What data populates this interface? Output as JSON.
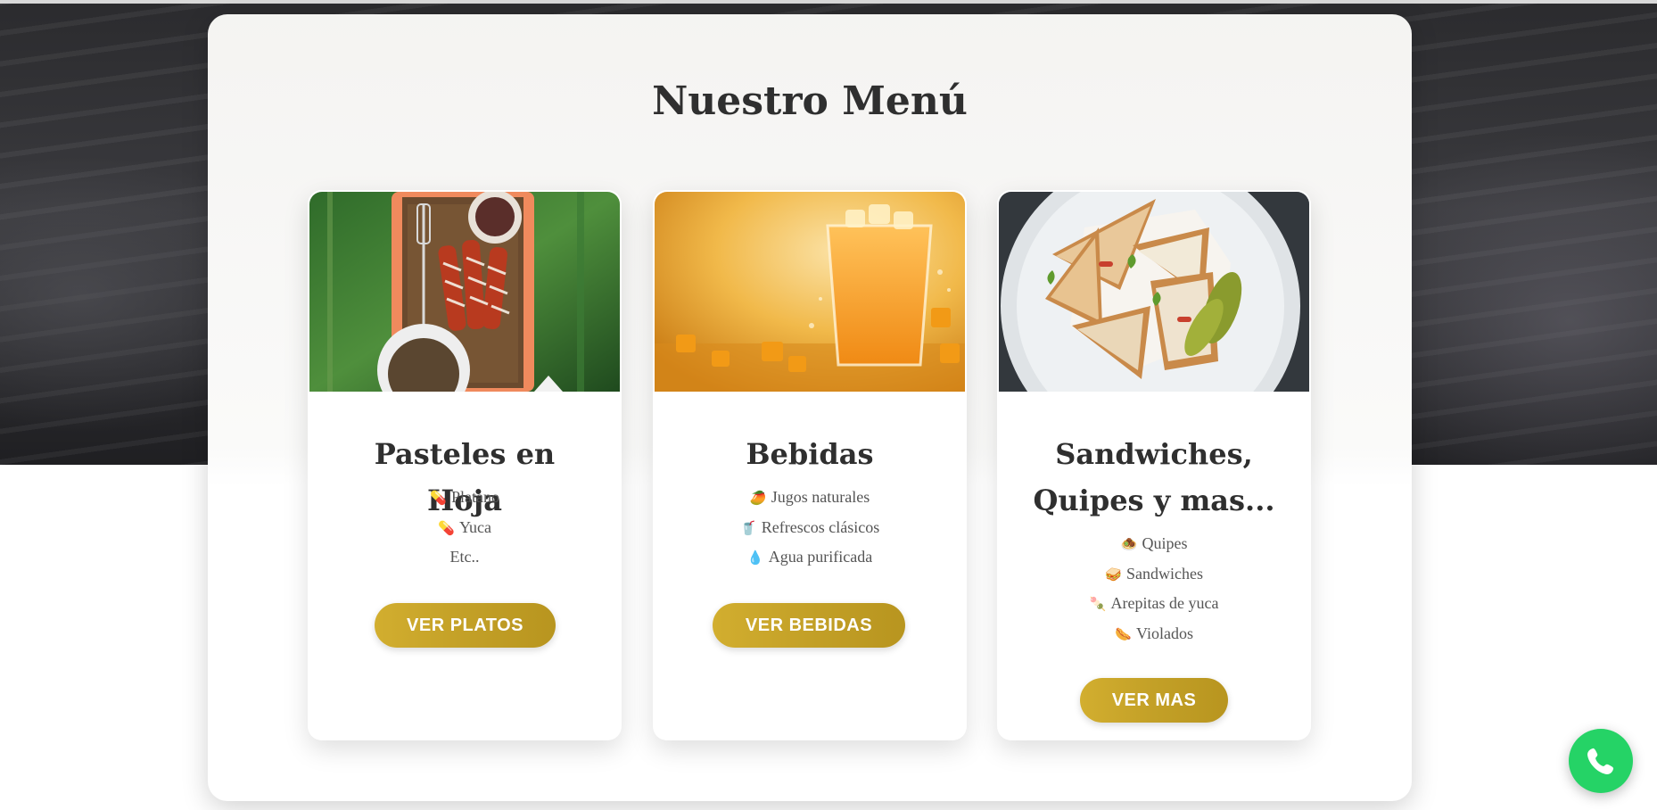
{
  "page": {
    "section_title": "Nuestro Menú"
  },
  "cards": [
    {
      "title": "Pasteles en Hoja",
      "items": [
        {
          "icon": "pill-icon",
          "text": "Platano"
        },
        {
          "icon": "pill-icon",
          "text": "Yuca"
        },
        {
          "icon": "",
          "text": "Etc.."
        }
      ],
      "button": "VER PLATOS",
      "image": "pasteles-en-hoja-photo"
    },
    {
      "title": "Bebidas",
      "items": [
        {
          "icon": "mango-icon",
          "text": "Jugos naturales"
        },
        {
          "icon": "soda-cup-icon",
          "text": "Refrescos clásicos"
        },
        {
          "icon": "droplet-icon",
          "text": "Agua purificada"
        }
      ],
      "button": "VER BEBIDAS",
      "image": "mango-juice-photo"
    },
    {
      "title": "Sandwiches, Quipes y mas...",
      "items": [
        {
          "icon": "kibbeh-icon",
          "text": "Quipes"
        },
        {
          "icon": "sandwich-icon",
          "text": "Sandwiches"
        },
        {
          "icon": "arepa-icon",
          "text": "Arepitas de yuca"
        },
        {
          "icon": "sausage-icon",
          "text": "Violados"
        }
      ],
      "button": "VER MAS",
      "image": "club-sandwich-photo"
    }
  ],
  "colors": {
    "accent_gold": "#c3a027",
    "whatsapp_green": "#25d366",
    "title_text": "#2f2f2f"
  },
  "floating": {
    "whatsapp_icon": "phone-icon"
  }
}
